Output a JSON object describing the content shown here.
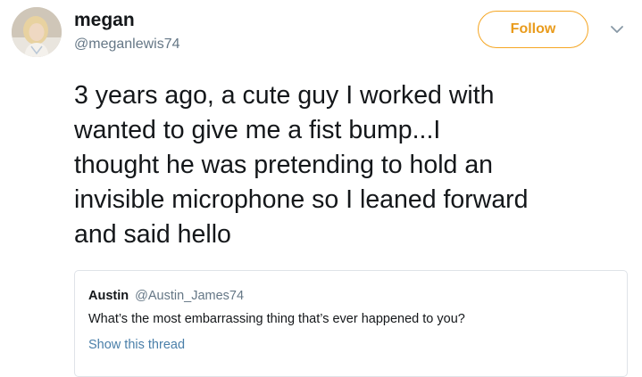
{
  "user": {
    "display_name": "megan",
    "handle": "@meganlewis74"
  },
  "follow_button": {
    "label": "Follow"
  },
  "tweet": {
    "lines": [
      "3 years ago, a cute guy I worked with",
      "wanted to give me a fist bump...I",
      "thought he was pretending to hold an",
      "invisible microphone so I leaned forward",
      "and said hello"
    ]
  },
  "quoted_tweet": {
    "name": "Austin",
    "handle": "@Austin_James74",
    "text": "What’s the most embarrassing thing that’s ever happened to you?",
    "link_label": "Show this thread"
  },
  "colors": {
    "accent": "#f5a623",
    "text": "#14171a",
    "muted": "#657786",
    "link": "#4a7fa9",
    "border": "#dfe3e8"
  },
  "icons": {
    "avatar": "user-avatar",
    "menu": "chevron-down-icon"
  }
}
